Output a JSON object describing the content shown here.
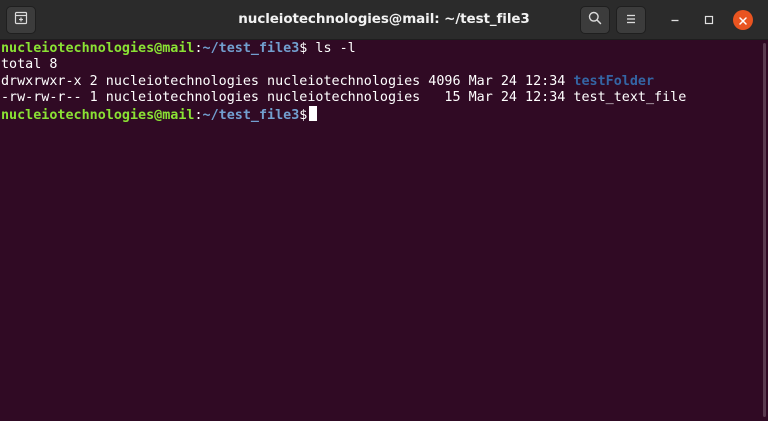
{
  "window": {
    "title": "nucleiotechnologies@mail: ~/test_file3"
  },
  "titlebar": {
    "icons": {
      "new_tab": "new-tab-icon",
      "search": "search-icon",
      "menu": "hamburger-menu-icon",
      "minimize": "minimize-icon",
      "maximize": "maximize-icon",
      "close": "close-icon"
    }
  },
  "colors": {
    "terminal_bg": "#300a24",
    "prompt_user": "#8ae234",
    "prompt_path": "#729fcf",
    "directory_name": "#3465a4",
    "close_button": "#e95420"
  },
  "terminal": {
    "prompt1": {
      "user": "nucleiotechnologies@mail",
      "sep": ":",
      "path": "~/test_file3",
      "symbol": "$",
      "command": " ls -l"
    },
    "total": "total 8",
    "entries": [
      {
        "details": "drwxrwxr-x 2 nucleiotechnologies nucleiotechnologies 4096 Mar 24 12:34 ",
        "name": "testFolder"
      },
      {
        "details": "-rw-rw-r-- 1 nucleiotechnologies nucleiotechnologies   15 Mar 24 12:34 ",
        "name": "test_text_file"
      }
    ],
    "prompt2": {
      "user": "nucleiotechnologies@mail",
      "sep": ":",
      "path": "~/test_file3",
      "symbol": "$"
    }
  }
}
